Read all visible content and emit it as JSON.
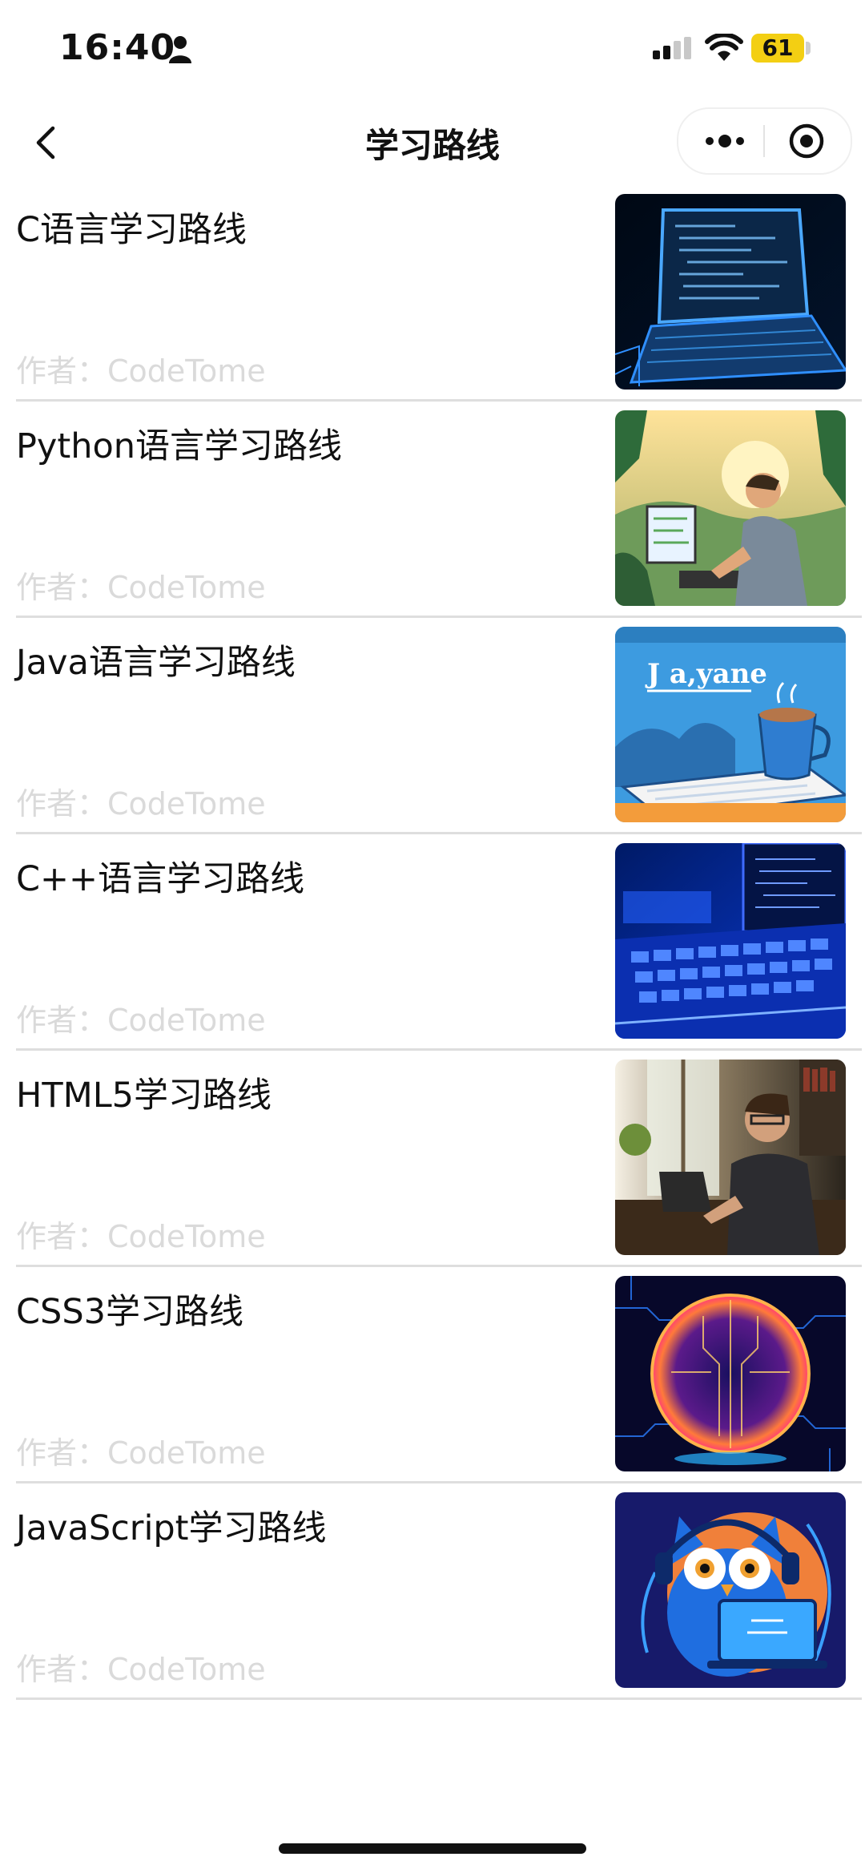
{
  "status_bar": {
    "time": "16:40",
    "battery": "61",
    "battery_color": "#f3cf13"
  },
  "nav": {
    "title": "学习路线",
    "back_icon": "chevron-left-icon",
    "more_icon": "more-dots-icon",
    "close_icon": "target-circle-icon"
  },
  "items": [
    {
      "title": "C语言学习路线",
      "author": "作者：CodeTome",
      "thumb": "laptop-code-dark-image"
    },
    {
      "title": "Python语言学习路线",
      "author": "作者：CodeTome",
      "thumb": "man-coding-jungle-image"
    },
    {
      "title": "Java语言学习路线",
      "author": "作者：CodeTome",
      "thumb": "java-coffee-cup-image",
      "thumb_text": "J a,yane"
    },
    {
      "title": "C++语言学习路线",
      "author": "作者：CodeTome",
      "thumb": "blue-keyboard-image"
    },
    {
      "title": "HTML5学习路线",
      "author": "作者：CodeTome",
      "thumb": "man-at-desk-photo"
    },
    {
      "title": "CSS3学习路线",
      "author": "作者：CodeTome",
      "thumb": "circuit-globe-image"
    },
    {
      "title": "JavaScript学习路线",
      "author": "作者：CodeTome",
      "thumb": "owl-laptop-image"
    }
  ]
}
